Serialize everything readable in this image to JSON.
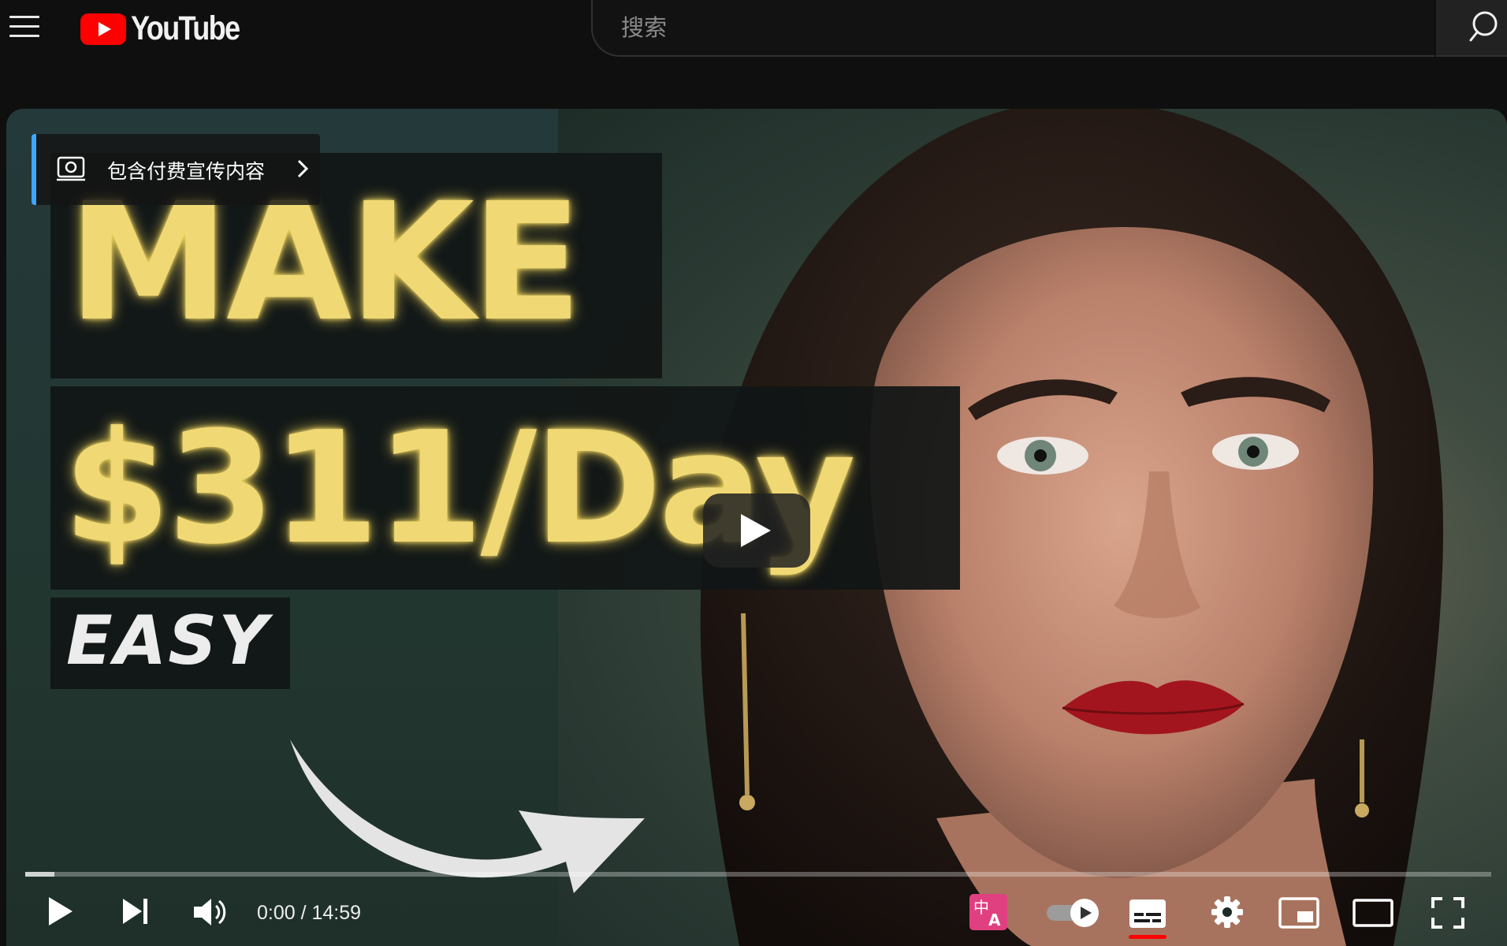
{
  "app": {
    "name": "YouTube"
  },
  "header": {
    "logo_text": "YouTube",
    "search": {
      "placeholder": "搜索",
      "value": ""
    }
  },
  "thumbnail": {
    "line1": "MAKE",
    "line2": "$311/Day",
    "line3": "EASY"
  },
  "promo_badge": {
    "label": "包含付费宣传内容"
  },
  "player": {
    "current_time": "0:00",
    "duration": "14:59",
    "time_display": "0:00 / 14:59",
    "progress_fraction": 0.02,
    "autoplay": "on",
    "subtitles": "on"
  },
  "colors": {
    "brand_red": "#ff0000",
    "headline_yellow": "#f0d874",
    "progress_fill": "#ffffff",
    "promo_accent": "#3ea6ff"
  },
  "icons": [
    "menu-icon",
    "youtube-logo-icon",
    "search-icon",
    "paid-promotion-icon",
    "chevron-right-icon",
    "big-play-icon",
    "play-icon",
    "next-icon",
    "volume-icon",
    "translate-icon",
    "autoplay-toggle-icon",
    "subtitles-icon",
    "settings-icon",
    "miniplayer-icon",
    "theater-mode-icon",
    "fullscreen-icon"
  ]
}
